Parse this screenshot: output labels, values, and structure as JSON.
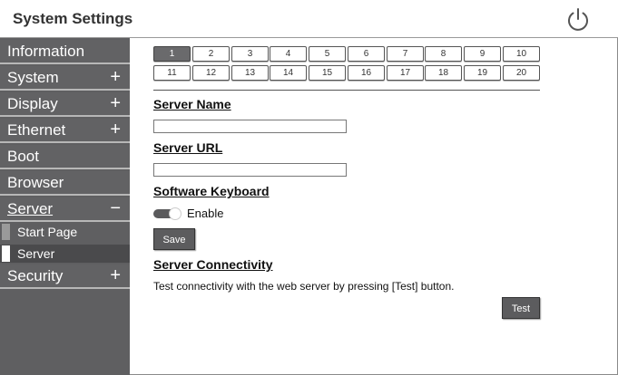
{
  "header": {
    "title": "System Settings",
    "power_icon": "power-icon"
  },
  "sidebar": {
    "items": [
      {
        "label": "Information",
        "sign": ""
      },
      {
        "label": "System",
        "sign": "+"
      },
      {
        "label": "Display",
        "sign": "+"
      },
      {
        "label": "Ethernet",
        "sign": "+"
      },
      {
        "label": "Boot",
        "sign": ""
      },
      {
        "label": "Browser",
        "sign": ""
      },
      {
        "label": "Server",
        "sign": "−"
      },
      {
        "label": "Security",
        "sign": "+"
      }
    ],
    "subitems": [
      {
        "label": "Start Page"
      },
      {
        "label": "Server"
      }
    ]
  },
  "pager": {
    "pages": [
      "1",
      "2",
      "3",
      "4",
      "5",
      "6",
      "7",
      "8",
      "9",
      "10",
      "11",
      "12",
      "13",
      "14",
      "15",
      "16",
      "17",
      "18",
      "19",
      "20"
    ],
    "selected": "1"
  },
  "form": {
    "server_name_heading": "Server Name",
    "server_name_value": "",
    "server_url_heading": "Server URL",
    "server_url_value": "",
    "keyboard_heading": "Software Keyboard",
    "keyboard_toggle_label": "Enable",
    "keyboard_enabled": true,
    "save_label": "Save",
    "connectivity_heading": "Server Connectivity",
    "connectivity_desc": "Test connectivity with the web server by pressing [Test] button.",
    "test_label": "Test"
  },
  "colors": {
    "sidebar_bg": "#626264",
    "button_bg": "#5c5c5e",
    "accent": "#ffffff"
  }
}
